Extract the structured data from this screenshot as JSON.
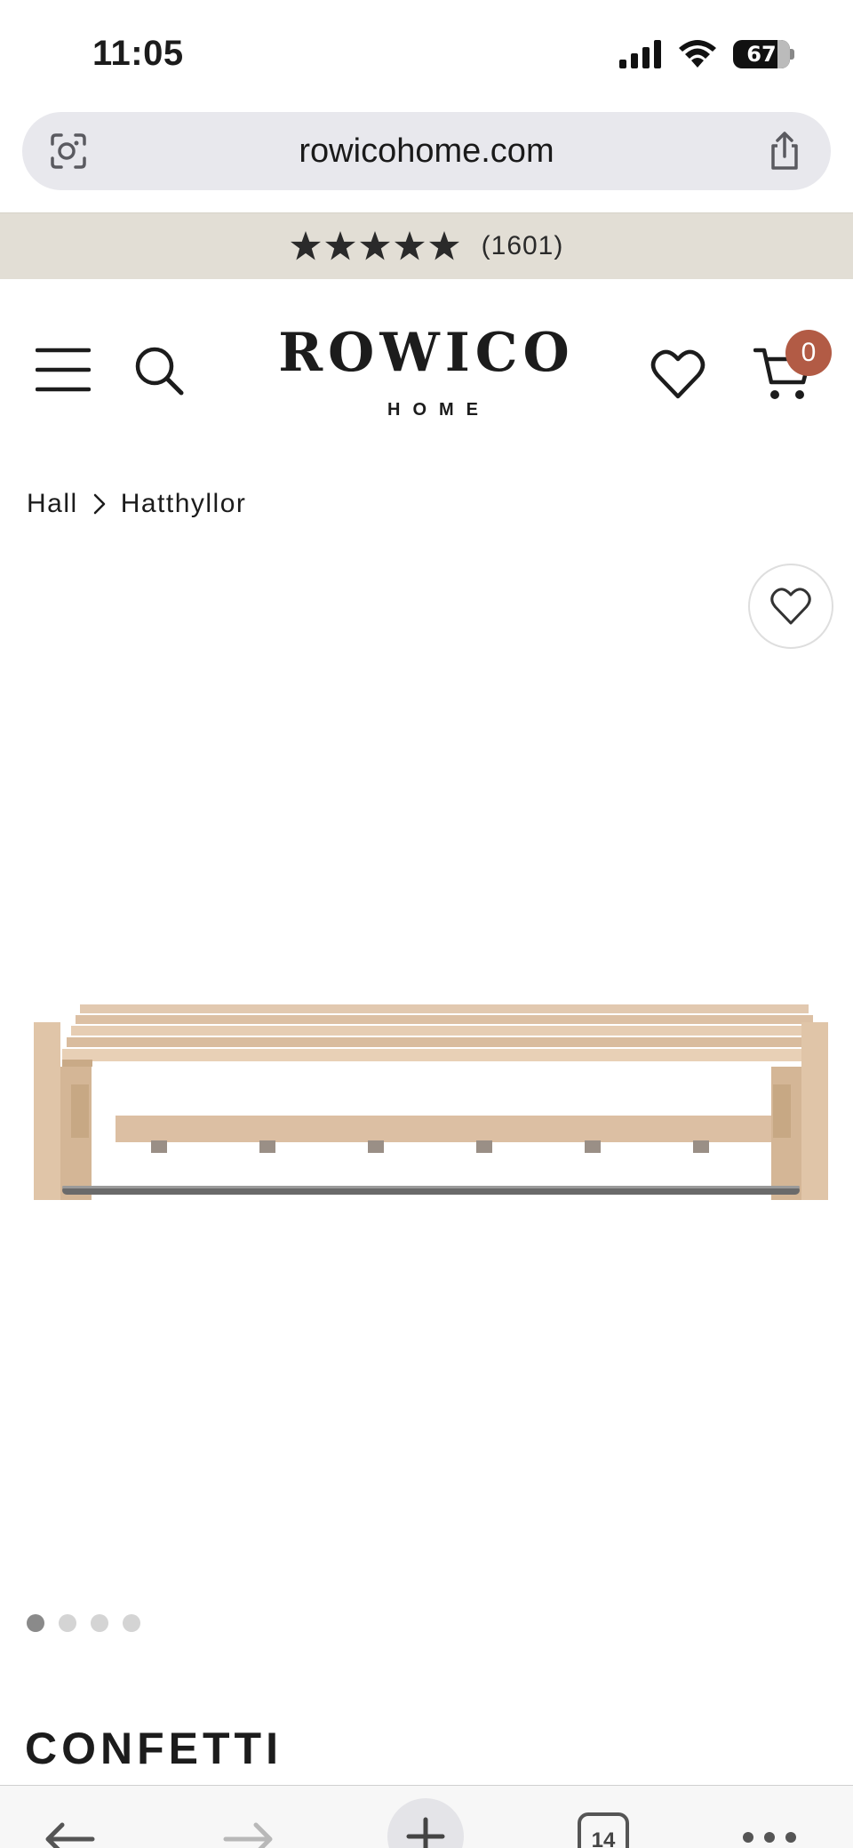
{
  "status_bar": {
    "time": "11:05",
    "battery": "67"
  },
  "browser": {
    "url": "rowicohome.com"
  },
  "rating": {
    "stars": 5,
    "count": "(1601)",
    "star_color": "#2a2a2a",
    "strip_color": "#e2ded5"
  },
  "header": {
    "logo_title": "ROWICO",
    "logo_subtitle": "HOME",
    "cart_count": "0",
    "cart_badge_color": "#b25b45"
  },
  "breadcrumb": {
    "items": [
      "Hall",
      "Hatthyllor"
    ],
    "separator_icon": "chevron-right-icon"
  },
  "product": {
    "title": "CONFETTI",
    "carousel": {
      "total": 4,
      "active": 1
    }
  },
  "toolbar": {
    "tab_count": "14"
  },
  "icons": {
    "url_left": "camera-search-icon",
    "url_right": "share-icon",
    "menu": "menu-icon",
    "search": "search-icon",
    "wishlist": "heart-icon",
    "cart": "cart-icon",
    "back": "arrow-left-icon",
    "forward": "arrow-right-icon",
    "new_tab": "plus-icon",
    "more": "more-icon"
  }
}
